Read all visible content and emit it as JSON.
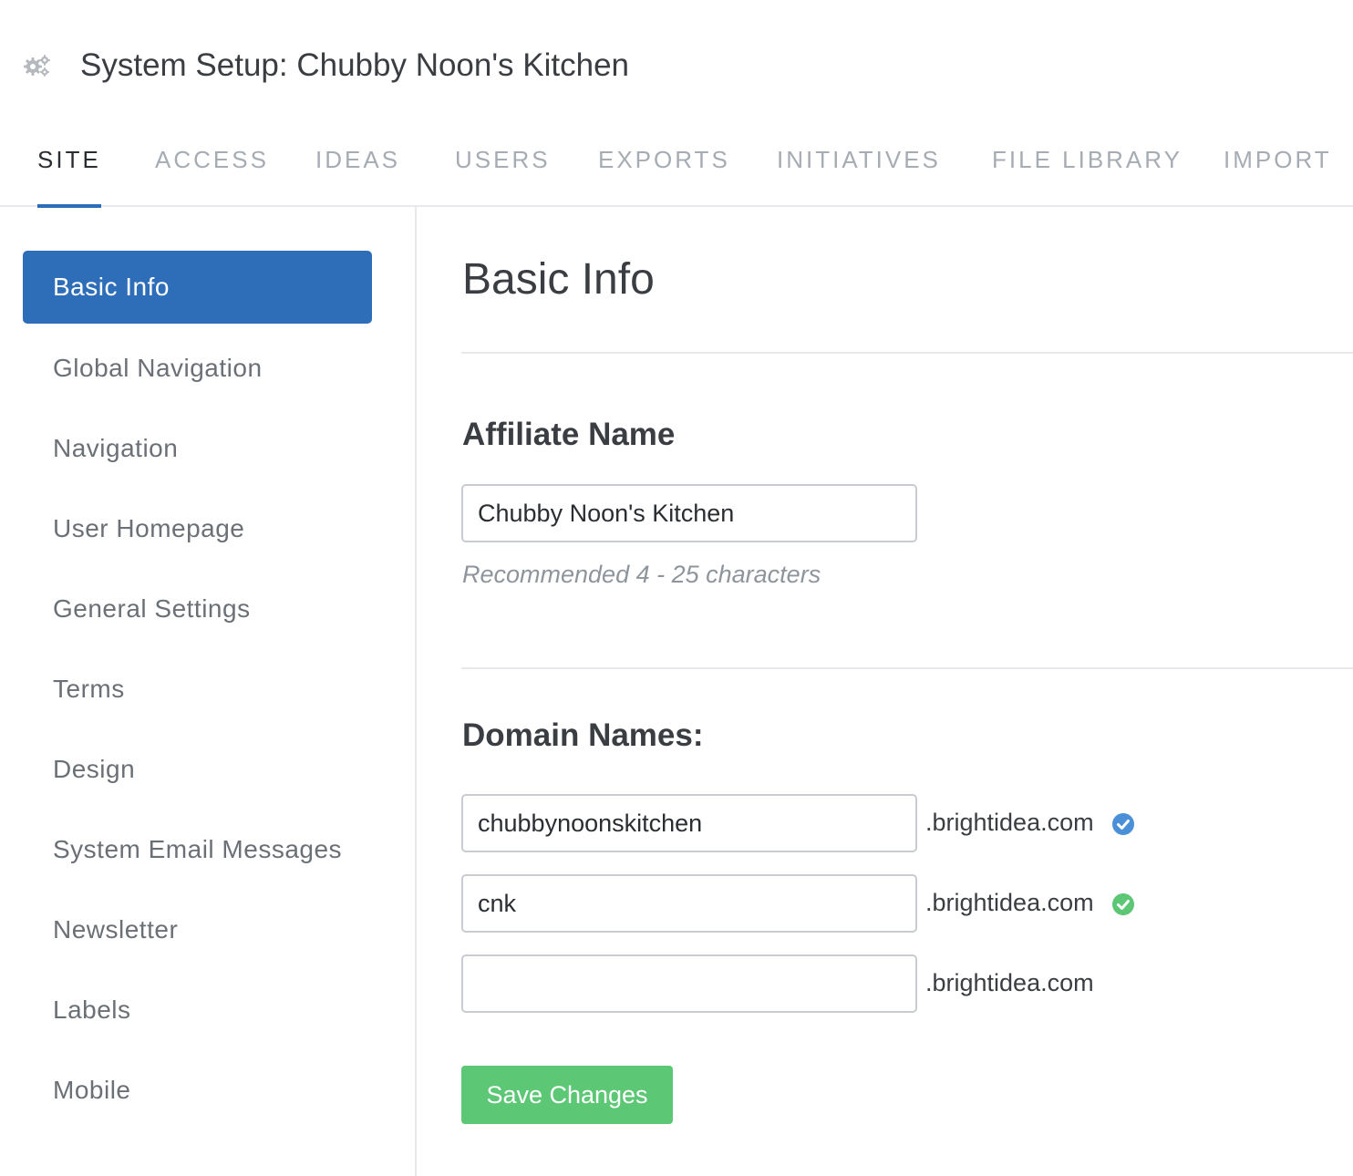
{
  "header": {
    "icon": "gear-icon",
    "title": "System Setup: Chubby Noon's Kitchen"
  },
  "tabs": [
    {
      "label": "SITE",
      "active": true
    },
    {
      "label": "ACCESS"
    },
    {
      "label": "IDEAS"
    },
    {
      "label": "USERS"
    },
    {
      "label": "EXPORTS"
    },
    {
      "label": "INITIATIVES"
    },
    {
      "label": "FILE LIBRARY"
    },
    {
      "label": "IMPORT"
    }
  ],
  "sidebar": {
    "items": [
      {
        "label": "Basic Info",
        "active": true
      },
      {
        "label": "Global Navigation"
      },
      {
        "label": "Navigation"
      },
      {
        "label": "User Homepage"
      },
      {
        "label": "General Settings"
      },
      {
        "label": "Terms"
      },
      {
        "label": "Design"
      },
      {
        "label": "System Email Messages"
      },
      {
        "label": "Newsletter"
      },
      {
        "label": "Labels"
      },
      {
        "label": "Mobile"
      }
    ]
  },
  "main": {
    "title": "Basic Info",
    "affiliate": {
      "heading": "Affiliate Name",
      "value": "Chubby Noon's Kitchen",
      "hint": "Recommended 4 - 25 characters"
    },
    "domains": {
      "heading": "Domain Names:",
      "entries": [
        {
          "value": "chubbynoonskitchen",
          "suffix": ".brightidea.com",
          "status_icon": "check-circle-blue-icon"
        },
        {
          "value": "cnk",
          "suffix": ".brightidea.com",
          "status_icon": "check-circle-green-icon"
        },
        {
          "value": "",
          "suffix": ".brightidea.com"
        }
      ]
    },
    "save_label": "Save Changes"
  },
  "colors": {
    "primary": "#2e6eb8",
    "success": "#5cc775",
    "verified_blue": "#4a90d9",
    "verified_green": "#5cc775"
  }
}
